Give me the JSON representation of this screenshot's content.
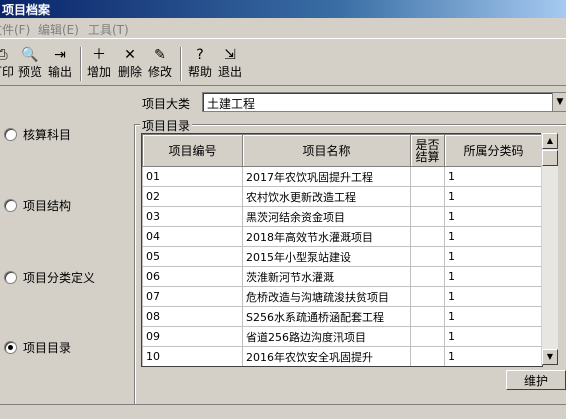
{
  "window": {
    "title": "项目档案"
  },
  "menu": [
    {
      "label": "文件(F)"
    },
    {
      "label": "编辑(E)"
    },
    {
      "label": "工具(T)"
    }
  ],
  "toolbar": [
    {
      "label": "打印",
      "icon": "printer-icon",
      "glyph": "⎙"
    },
    {
      "label": "预览",
      "icon": "preview-icon",
      "glyph": "🔍"
    },
    {
      "label": "输出",
      "icon": "export-icon",
      "glyph": "⇥"
    },
    {
      "label": "增加",
      "icon": "add-icon",
      "glyph": "＋"
    },
    {
      "label": "删除",
      "icon": "delete-icon",
      "glyph": "✕"
    },
    {
      "label": "修改",
      "icon": "edit-icon",
      "glyph": "✎"
    },
    {
      "label": "帮助",
      "icon": "help-icon",
      "glyph": "?"
    },
    {
      "label": "退出",
      "icon": "exit-icon",
      "glyph": "⇲"
    }
  ],
  "left_options": [
    {
      "label": "核算科目",
      "selected": false
    },
    {
      "label": "项目结构",
      "selected": false
    },
    {
      "label": "项目分类定义",
      "selected": false
    },
    {
      "label": "项目目录",
      "selected": true
    }
  ],
  "category": {
    "label": "项目大类",
    "value": "土建工程"
  },
  "directory": {
    "title": "项目目录",
    "columns": [
      "项目编号",
      "项目名称",
      "是否结算",
      "所属分类码"
    ],
    "rows": [
      [
        "01",
        "2017年农饮巩固提升工程",
        "",
        "1"
      ],
      [
        "02",
        "农村饮水更新改造工程",
        "",
        "1"
      ],
      [
        "03",
        "黑茨河结余资金项目",
        "",
        "1"
      ],
      [
        "04",
        "2018年高效节水灌溉项目",
        "",
        "1"
      ],
      [
        "05",
        "2015年小型泵站建设",
        "",
        "1"
      ],
      [
        "06",
        "茨淮新河节水灌溉",
        "",
        "1"
      ],
      [
        "07",
        "危桥改造与沟塘疏浚扶贫项目",
        "",
        "1"
      ],
      [
        "08",
        "S256水系疏通桥涵配套工程",
        "",
        "1"
      ],
      [
        "09",
        "省道256路边沟度汛项目",
        "",
        "1"
      ],
      [
        "10",
        "2016年农饮安全巩固提升",
        "",
        "1"
      ]
    ]
  },
  "maintain_button": "维护"
}
